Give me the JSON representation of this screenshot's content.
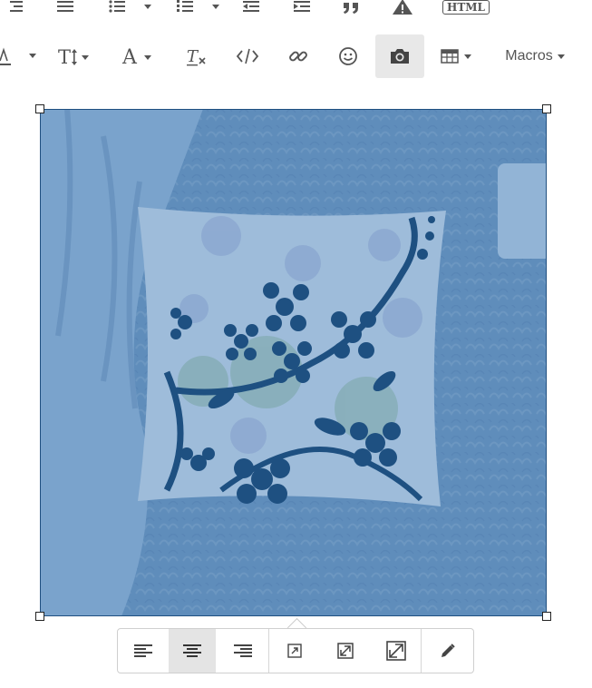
{
  "toolbar": {
    "macros_label": "Macros",
    "html_label": "HTML"
  },
  "colors": {
    "icon": "#555555",
    "active_bg": "#e8e8e8",
    "image_tint": "#6a93bd",
    "pillow_pattern": "#1c4a77"
  },
  "icons_row1": [
    "align-right-icon",
    "justify-icon",
    "unordered-list-icon",
    "ordered-list-icon",
    "outdent-icon",
    "indent-icon",
    "blockquote-icon",
    "warning-icon",
    "html-icon"
  ],
  "icons_row2": [
    "font-color-icon",
    "font-size-icon",
    "font-family-icon",
    "clear-formatting-icon",
    "code-icon",
    "link-icon",
    "emoticon-icon",
    "insert-image-icon",
    "table-icon",
    "macros-dropdown"
  ],
  "image": {
    "subject": "patterned throw pillow on a fluffy rug",
    "selected": true
  },
  "image_popup": {
    "buttons": [
      "align-left-icon",
      "align-center-icon",
      "align-right-icon",
      "small-size-icon",
      "medium-size-icon",
      "large-size-icon",
      "edit-icon"
    ],
    "active": "align-center-icon"
  }
}
